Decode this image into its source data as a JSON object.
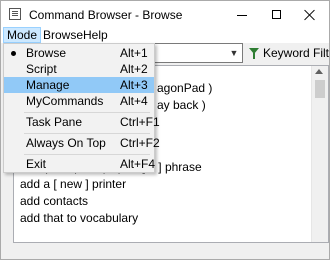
{
  "window": {
    "title": "Command Browser - Browse"
  },
  "menubar": {
    "items": [
      "Mode",
      "Browse",
      "Help"
    ]
  },
  "toolbar": {
    "search_value": "",
    "keyword_filter_label": "Keyword Filter"
  },
  "mode_menu": {
    "items": [
      {
        "label": "Browse",
        "accel": "Alt+1",
        "checked": true
      },
      {
        "label": "Script",
        "accel": "Alt+2"
      },
      {
        "label": "Manage",
        "accel": "Alt+3",
        "highlighted": true
      },
      {
        "label": "MyCommands",
        "accel": "Alt+4"
      },
      {
        "label": "Task Pane",
        "accel": "Ctrl+F1"
      },
      {
        "label": "Always On Top",
        "accel": "Ctrl+F2"
      },
      {
        "label": "Exit",
        "accel": "Alt+F4"
      }
    ]
  },
  "list": {
    "partial_items": [
      "agonPad )",
      "ay back )",
      "add ( that | this | it ) as [ a ] phrase"
    ],
    "items": [
      "add a [ new ] printer",
      "add contacts",
      "add that to vocabulary"
    ]
  },
  "icons": {
    "app": "app-window-icon",
    "minimize": "minimize-icon",
    "maximize": "maximize-icon",
    "close": "close-icon",
    "dropdown": "chevron-down-icon",
    "filter": "funnel-icon",
    "checked": "radio-bullet-icon"
  },
  "colors": {
    "menu_highlight": "#91c9f7",
    "menubar_active": "#cce8ff",
    "filter_icon": "#2e7d32"
  }
}
